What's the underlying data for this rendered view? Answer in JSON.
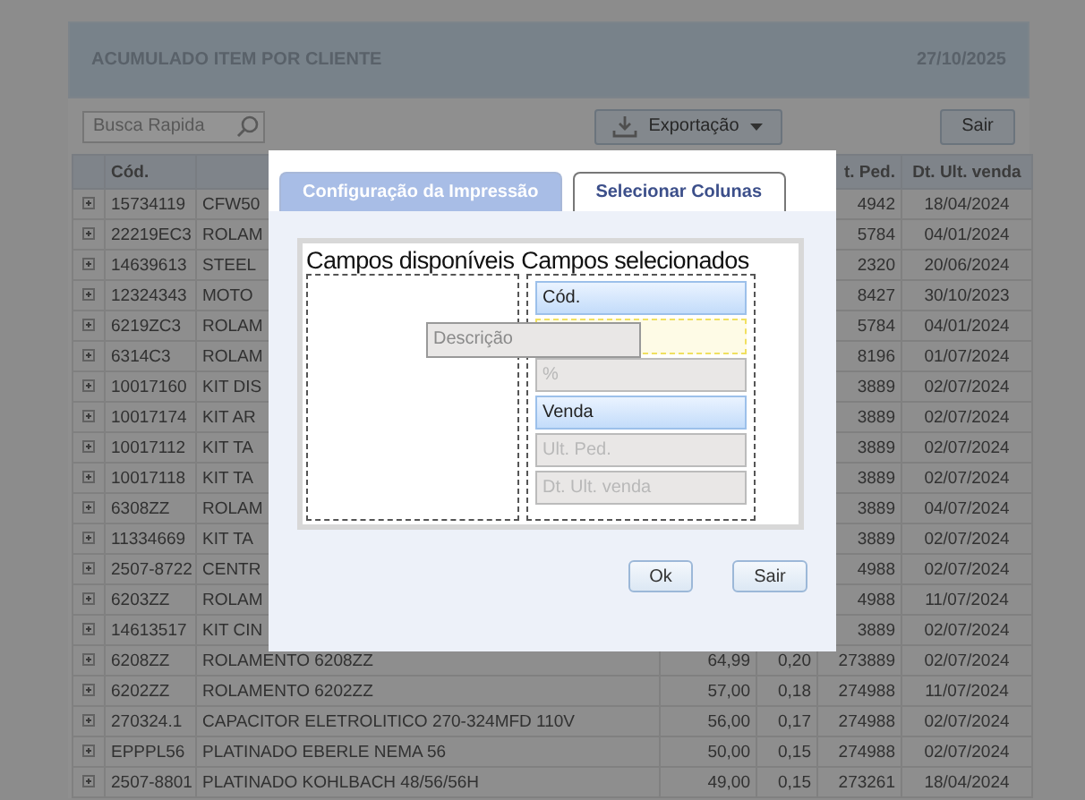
{
  "header": {
    "title": "ACUMULADO ITEM POR CLIENTE",
    "date": "27/10/2025"
  },
  "toolbar": {
    "search": {
      "placeholder": "Busca Rapida"
    },
    "export_button": "Exportação",
    "exit_button": "Sair"
  },
  "table": {
    "columns": {
      "code": "Cód.",
      "last_order": "t. Ped.",
      "last_sale_date": "Dt. Ult. venda"
    },
    "rows": [
      {
        "code": "15734119",
        "description": "CFW50",
        "last_order": "4942",
        "last_sale_date": "18/04/2024"
      },
      {
        "code": "22219EC3",
        "description": "ROLAM",
        "last_order": "5784",
        "last_sale_date": "04/01/2024"
      },
      {
        "code": "14639613",
        "description": "STEEL",
        "last_order": "2320",
        "last_sale_date": "20/06/2024"
      },
      {
        "code": "12324343",
        "description": "MOTO",
        "last_order": "8427",
        "last_sale_date": "30/10/2023"
      },
      {
        "code": "6219ZC3",
        "description": "ROLAM",
        "last_order": "5784",
        "last_sale_date": "04/01/2024"
      },
      {
        "code": "6314C3",
        "description": "ROLAM",
        "last_order": "8196",
        "last_sale_date": "01/07/2024"
      },
      {
        "code": "10017160",
        "description": "KIT DIS",
        "last_order": "3889",
        "last_sale_date": "02/07/2024"
      },
      {
        "code": "10017174",
        "description": "KIT AR",
        "last_order": "3889",
        "last_sale_date": "02/07/2024"
      },
      {
        "code": "10017112",
        "description": "KIT TA",
        "last_order": "3889",
        "last_sale_date": "02/07/2024"
      },
      {
        "code": "10017118",
        "description": "KIT TA",
        "last_order": "3889",
        "last_sale_date": "02/07/2024"
      },
      {
        "code": "6308ZZ",
        "description": "ROLAM",
        "last_order": "3889",
        "last_sale_date": "04/07/2024"
      },
      {
        "code": "11334669",
        "description": "KIT TA",
        "last_order": "3889",
        "last_sale_date": "02/07/2024"
      },
      {
        "code": "2507-8722",
        "description": "CENTR",
        "last_order": "4988",
        "last_sale_date": "02/07/2024"
      },
      {
        "code": "6203ZZ",
        "description": "ROLAM",
        "last_order": "4988",
        "last_sale_date": "11/07/2024"
      },
      {
        "code": "14613517",
        "description": "KIT CIN",
        "last_order": "3889",
        "last_sale_date": "02/07/2024"
      },
      {
        "code": "6208ZZ",
        "description": "ROLAMENTO 6208ZZ",
        "sale": "64,99",
        "percent": "0,20",
        "last_order": "273889",
        "last_sale_date": "02/07/2024"
      },
      {
        "code": "6202ZZ",
        "description": "ROLAMENTO 6202ZZ",
        "sale": "57,00",
        "percent": "0,18",
        "last_order": "274988",
        "last_sale_date": "11/07/2024"
      },
      {
        "code": "270324.1",
        "description": "CAPACITOR ELETROLITICO 270-324MFD 110V",
        "sale": "56,00",
        "percent": "0,17",
        "last_order": "274988",
        "last_sale_date": "02/07/2024"
      },
      {
        "code": "EPPPL56",
        "description": "PLATINADO EBERLE NEMA 56",
        "sale": "50,00",
        "percent": "0,15",
        "last_order": "274988",
        "last_sale_date": "02/07/2024"
      },
      {
        "code": "2507-8801",
        "description": "PLATINADO KOHLBACH 48/56/56H",
        "sale": "49,00",
        "percent": "0,15",
        "last_order": "273261",
        "last_sale_date": "18/04/2024"
      }
    ]
  },
  "dialog": {
    "tabs": [
      {
        "label": "Configuração da Impressão",
        "selected": false
      },
      {
        "label": "Selecionar Colunas",
        "selected": true
      }
    ],
    "available_title": "Campos disponíveis",
    "selected_title": "Campos selecionados",
    "selected_fields": [
      {
        "kind": "field",
        "label": "Cód.",
        "disabled": false
      },
      {
        "kind": "drop-slot"
      },
      {
        "kind": "field",
        "label": "%",
        "disabled": true
      },
      {
        "kind": "field",
        "label": "Venda",
        "disabled": false
      },
      {
        "kind": "field",
        "label": "Ult. Ped.",
        "disabled": true
      },
      {
        "kind": "field",
        "label": "Dt. Ult. venda",
        "disabled": true
      }
    ],
    "dragged_field": {
      "label": "Descrição"
    },
    "buttons": [
      "Ok",
      "Sair"
    ]
  }
}
